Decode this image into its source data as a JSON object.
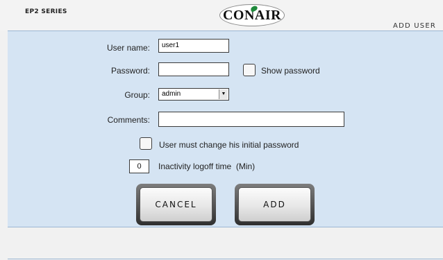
{
  "header": {
    "series": "EP2 SERIES",
    "logo_text": "CONAIR",
    "screen_title": "ADD USER"
  },
  "form": {
    "username_label": "User name:",
    "username_value": "user1",
    "password_label": "Password:",
    "password_value": "",
    "show_password_label": "Show password",
    "show_password_checked": false,
    "group_label": "Group:",
    "group_value": "admin",
    "comments_label": "Comments:",
    "comments_value": "",
    "must_change_label": "User must change his initial password",
    "must_change_checked": false,
    "inactivity_value": "0",
    "inactivity_label": "Inactivity logoff time  (Min)"
  },
  "buttons": {
    "cancel": "CANCEL",
    "add": "ADD"
  }
}
